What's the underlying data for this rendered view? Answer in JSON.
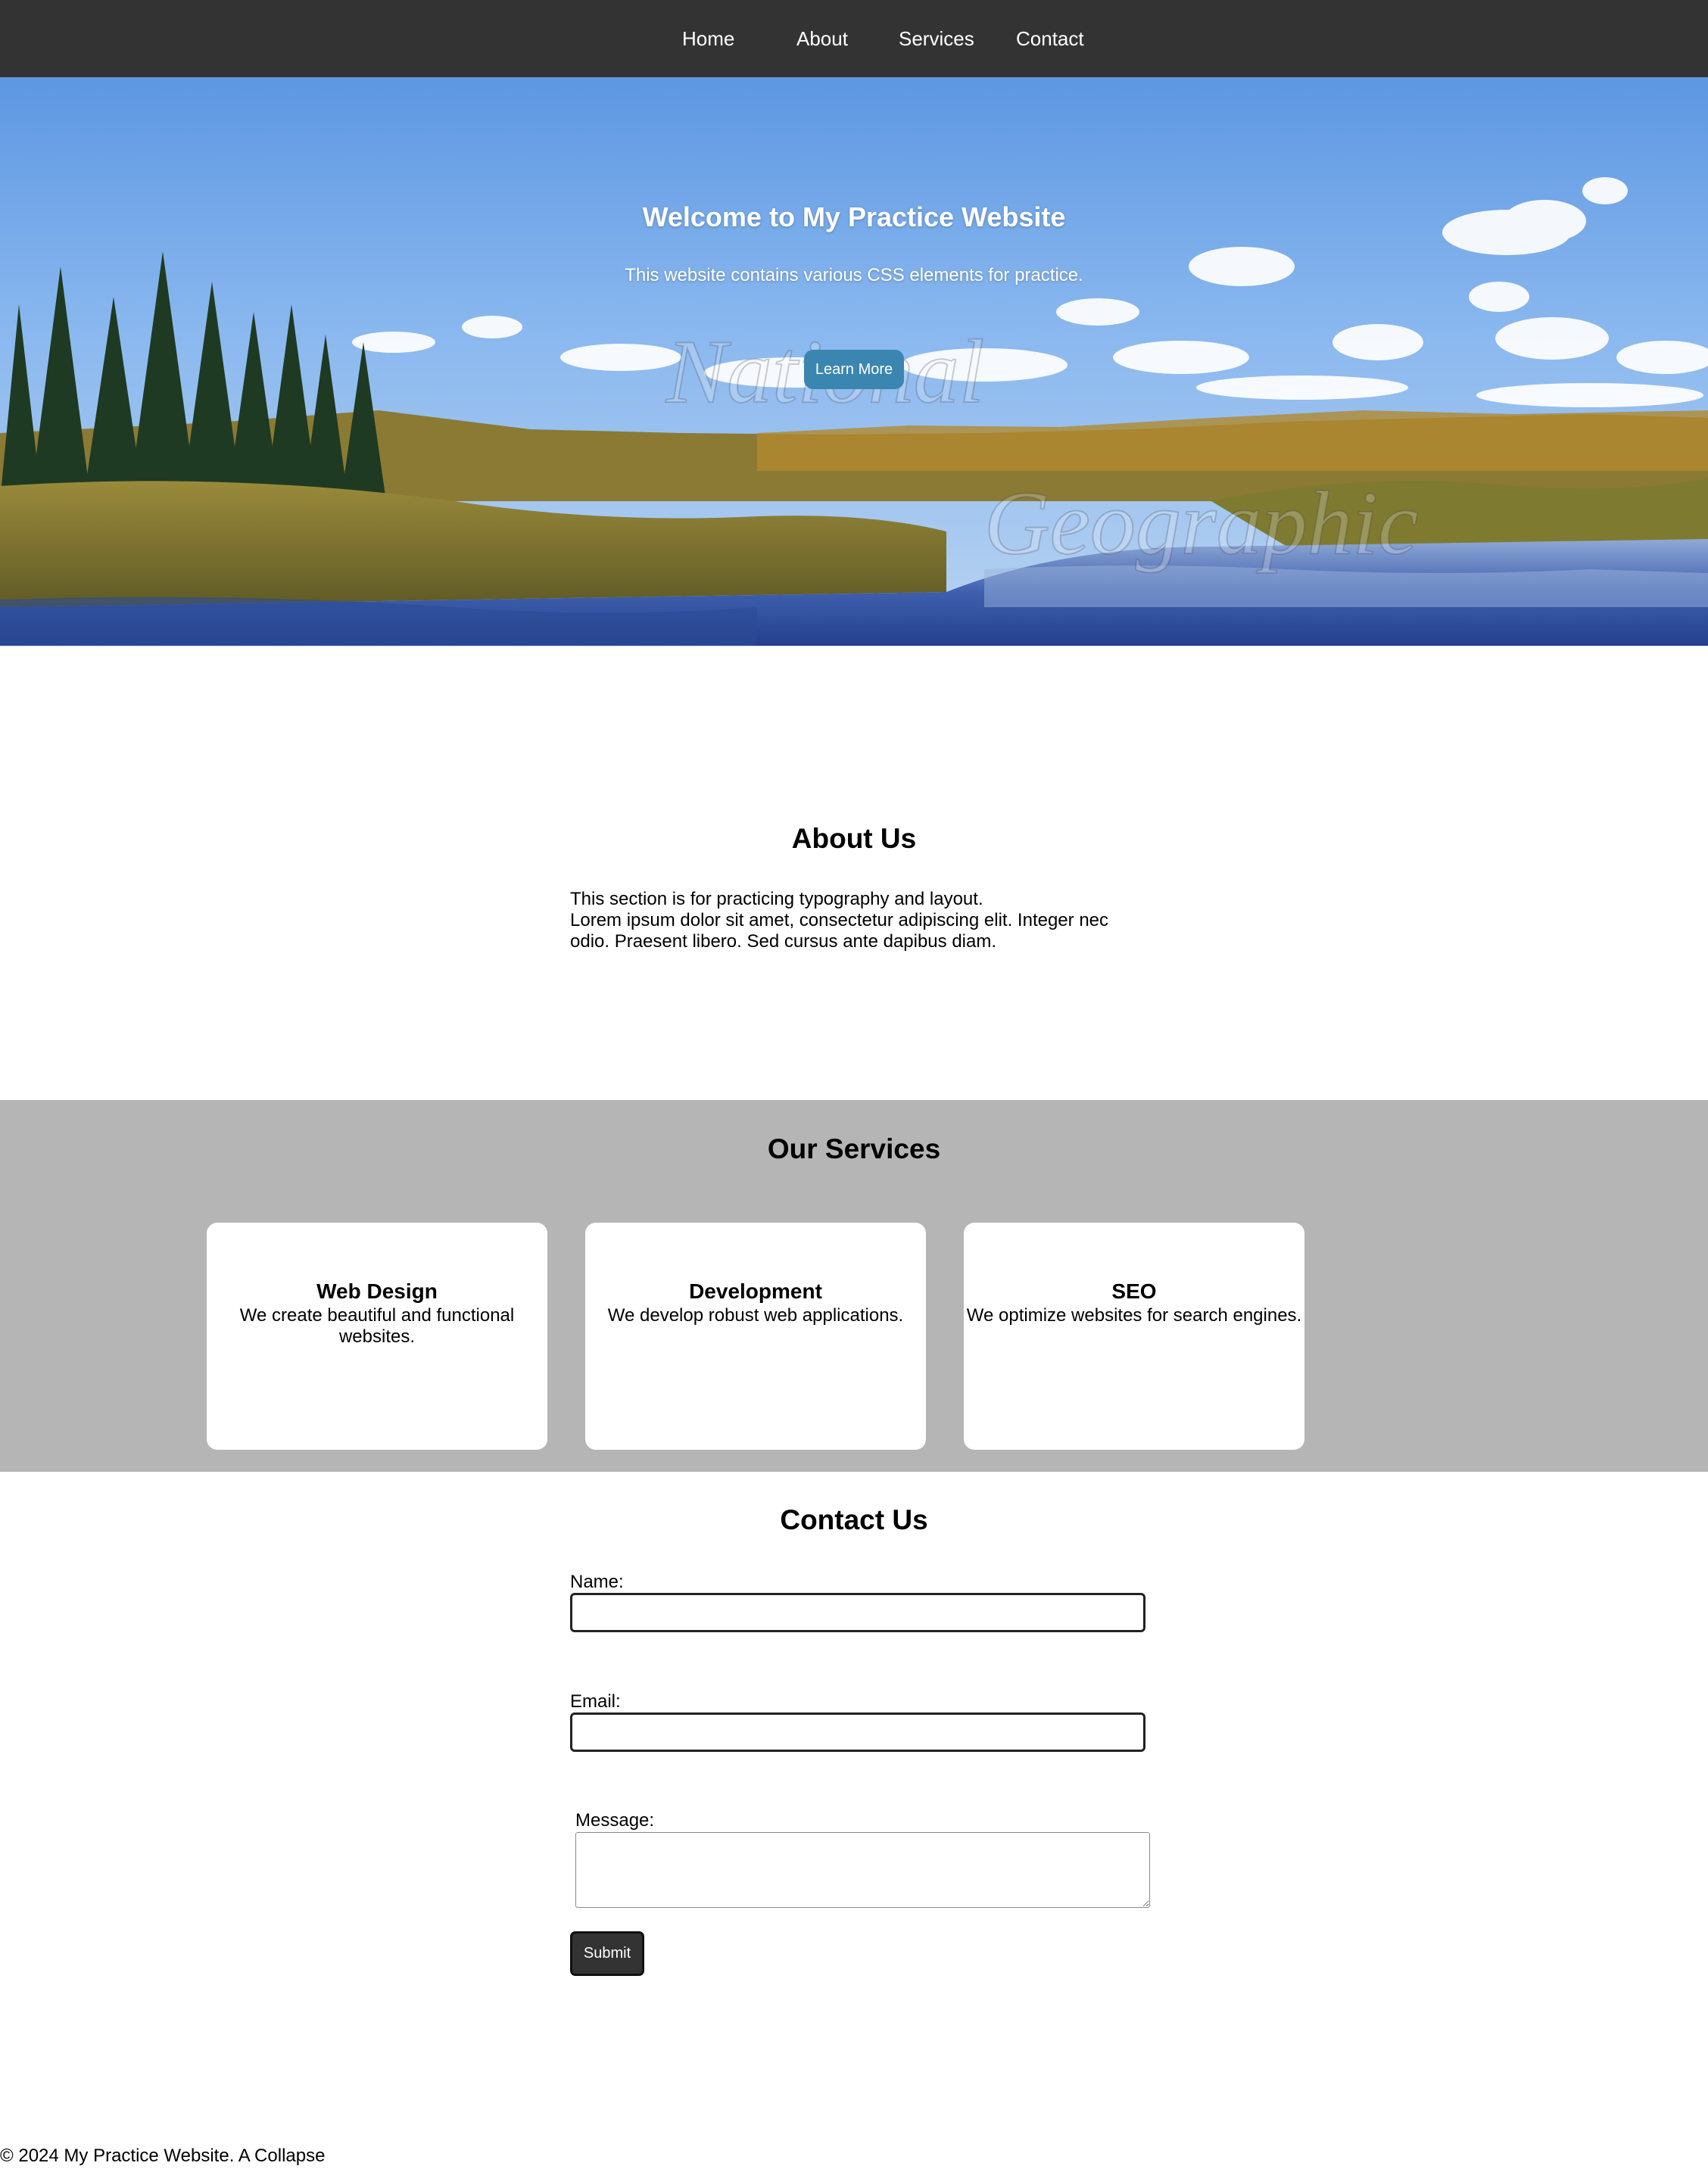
{
  "nav": {
    "items": [
      {
        "label": "Home"
      },
      {
        "label": "About"
      },
      {
        "label": "Services"
      },
      {
        "label": "Contact"
      }
    ]
  },
  "hero": {
    "title": "Welcome to My Practice Website",
    "subtitle": "This website contains various CSS elements for practice.",
    "button_label": "Learn More",
    "watermark_words": [
      "National",
      "Geographic"
    ]
  },
  "about": {
    "title": "About Us",
    "line1": "This section is for practicing typography and layout.",
    "line2": "Lorem ipsum dolor sit amet, consectetur adipiscing elit. Integer nec odio. Praesent libero. Sed cursus ante dapibus diam."
  },
  "services": {
    "title": "Our Services",
    "cards": [
      {
        "title": "Web Design",
        "text": "We create beautiful and functional websites."
      },
      {
        "title": "Development",
        "text": "We develop robust web applications."
      },
      {
        "title": "SEO",
        "text": "We optimize websites for search engines."
      }
    ]
  },
  "contact": {
    "title": "Contact Us",
    "name_label": "Name:",
    "name_value": "",
    "email_label": "Email:",
    "email_value": "",
    "message_label": "Message:",
    "message_value": "",
    "submit_label": "Submit"
  },
  "footer": {
    "text": "© 2024 My Practice Website. A Collapse"
  },
  "colors": {
    "nav_bg": "#333333",
    "accent_button": "#3a86b0",
    "services_bg": "#b5b5b5",
    "submit_bg": "#333333"
  }
}
